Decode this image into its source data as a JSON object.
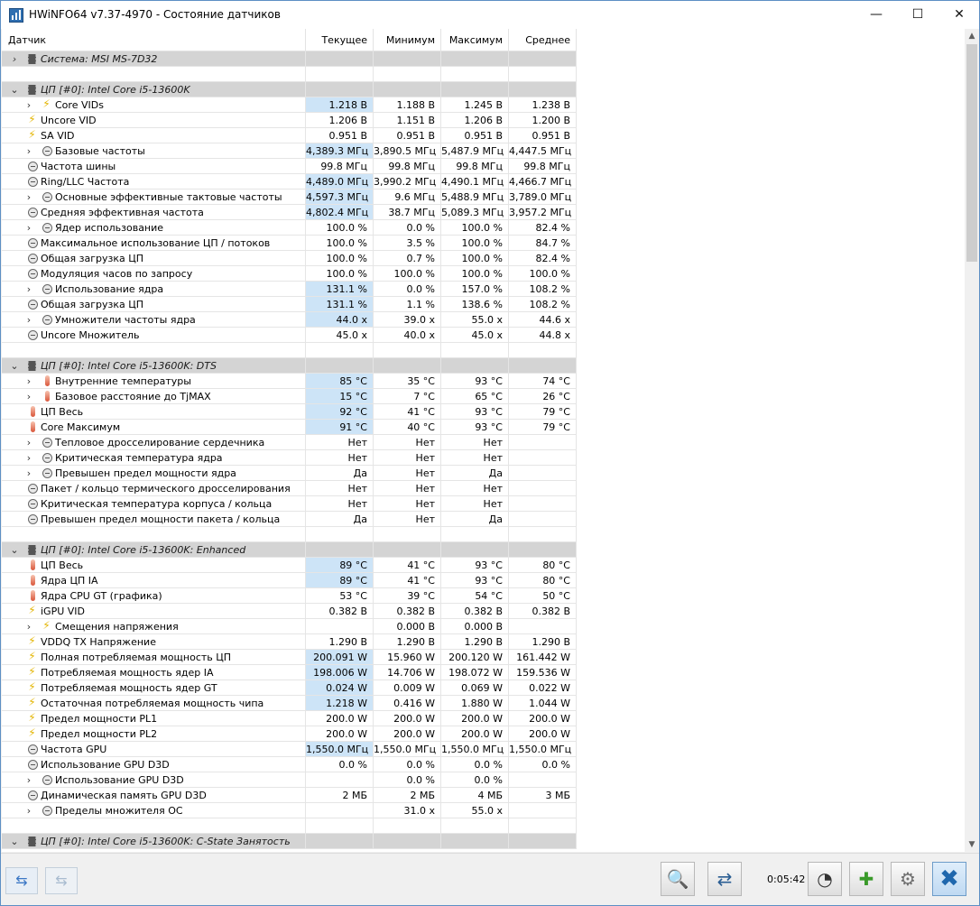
{
  "window": {
    "title": "HWiNFO64 v7.37-4970 - Состояние датчиков",
    "controls": {
      "minimize": "—",
      "maximize": "☐",
      "close": "✕"
    }
  },
  "columns": [
    "Датчик",
    "Текущее",
    "Минимум",
    "Максимум",
    "Среднее"
  ],
  "rows": [
    {
      "t": "section",
      "chev": "right",
      "label": "Система: MSI MS-7D32",
      "vals": [
        "",
        "",
        "",
        ""
      ]
    },
    {
      "t": "spacer"
    },
    {
      "t": "section",
      "chev": "down",
      "label": "ЦП [#0]: Intel Core i5-13600K",
      "vals": [
        "",
        "",
        "",
        ""
      ]
    },
    {
      "t": "item",
      "chev": true,
      "icon": "bolt",
      "label": "Core VIDs",
      "vals": [
        "1.218 В",
        "1.188 В",
        "1.245 В",
        "1.238 В"
      ],
      "hl": true
    },
    {
      "t": "item",
      "icon": "bolt",
      "label": "Uncore VID",
      "vals": [
        "1.206 В",
        "1.151 В",
        "1.206 В",
        "1.200 В"
      ]
    },
    {
      "t": "item",
      "icon": "bolt",
      "label": "SA VID",
      "vals": [
        "0.951 В",
        "0.951 В",
        "0.951 В",
        "0.951 В"
      ]
    },
    {
      "t": "item",
      "chev": true,
      "icon": "clock",
      "label": "Базовые частоты",
      "vals": [
        "4,389.3 МГц",
        "3,890.5 МГц",
        "5,487.9 МГц",
        "4,447.5 МГц"
      ],
      "hl": true
    },
    {
      "t": "item",
      "icon": "clock",
      "label": "Частота шины",
      "vals": [
        "99.8 МГц",
        "99.8 МГц",
        "99.8 МГц",
        "99.8 МГц"
      ]
    },
    {
      "t": "item",
      "icon": "clock",
      "label": "Ring/LLC Частота",
      "vals": [
        "4,489.0 МГц",
        "3,990.2 МГц",
        "4,490.1 МГц",
        "4,466.7 МГц"
      ],
      "hl": true
    },
    {
      "t": "item",
      "chev": true,
      "icon": "clock",
      "label": "Основные эффективные тактовые частоты",
      "vals": [
        "4,597.3 МГц",
        "9.6 МГц",
        "5,488.9 МГц",
        "3,789.0 МГц"
      ],
      "hl": true
    },
    {
      "t": "item",
      "icon": "clock",
      "label": "Средняя эффективная частота",
      "vals": [
        "4,802.4 МГц",
        "38.7 МГц",
        "5,089.3 МГц",
        "3,957.2 МГц"
      ],
      "hl": true
    },
    {
      "t": "item",
      "chev": true,
      "icon": "clock",
      "label": "Ядер использование",
      "vals": [
        "100.0 %",
        "0.0 %",
        "100.0 %",
        "82.4 %"
      ]
    },
    {
      "t": "item",
      "icon": "clock",
      "label": "Максимальное использование ЦП / потоков",
      "vals": [
        "100.0 %",
        "3.5 %",
        "100.0 %",
        "84.7 %"
      ]
    },
    {
      "t": "item",
      "icon": "clock",
      "label": "Общая загрузка ЦП",
      "vals": [
        "100.0 %",
        "0.7 %",
        "100.0 %",
        "82.4 %"
      ]
    },
    {
      "t": "item",
      "icon": "clock",
      "label": "Модуляция часов по запросу",
      "vals": [
        "100.0 %",
        "100.0 %",
        "100.0 %",
        "100.0 %"
      ]
    },
    {
      "t": "item",
      "chev": true,
      "icon": "clock",
      "label": "Использование ядра",
      "vals": [
        "131.1 %",
        "0.0 %",
        "157.0 %",
        "108.2 %"
      ],
      "hl": true
    },
    {
      "t": "item",
      "icon": "clock",
      "label": "Общая загрузка ЦП",
      "vals": [
        "131.1 %",
        "1.1 %",
        "138.6 %",
        "108.2 %"
      ],
      "hl": true
    },
    {
      "t": "item",
      "chev": true,
      "icon": "clock",
      "label": "Умножители частоты ядра",
      "vals": [
        "44.0 x",
        "39.0 x",
        "55.0 x",
        "44.6 x"
      ],
      "hl": true
    },
    {
      "t": "item",
      "icon": "clock",
      "label": "Uncore Множитель",
      "vals": [
        "45.0 x",
        "40.0 x",
        "45.0 x",
        "44.8 x"
      ]
    },
    {
      "t": "spacer"
    },
    {
      "t": "section",
      "chev": "down",
      "label": "ЦП [#0]: Intel Core i5-13600K: DTS",
      "vals": [
        "",
        "",
        "",
        ""
      ]
    },
    {
      "t": "item",
      "chev": true,
      "icon": "therm",
      "label": "Внутренние температуры",
      "vals": [
        "85 °C",
        "35 °C",
        "93 °C",
        "74 °C"
      ],
      "hl": true
    },
    {
      "t": "item",
      "chev": true,
      "icon": "therm",
      "label": "Базовое расстояние до TjMAX",
      "vals": [
        "15 °C",
        "7 °C",
        "65 °C",
        "26 °C"
      ],
      "hl": true
    },
    {
      "t": "item",
      "icon": "therm",
      "label": "ЦП Весь",
      "vals": [
        "92 °C",
        "41 °C",
        "93 °C",
        "79 °C"
      ],
      "hl": true
    },
    {
      "t": "item",
      "icon": "therm",
      "label": "Core Максимум",
      "vals": [
        "91 °C",
        "40 °C",
        "93 °C",
        "79 °C"
      ],
      "hl": true
    },
    {
      "t": "item",
      "chev": true,
      "icon": "clock",
      "label": "Тепловое дросселирование сердечника",
      "vals": [
        "Нет",
        "Нет",
        "Нет",
        ""
      ]
    },
    {
      "t": "item",
      "chev": true,
      "icon": "clock",
      "label": "Критическая температура ядра",
      "vals": [
        "Нет",
        "Нет",
        "Нет",
        ""
      ]
    },
    {
      "t": "item",
      "chev": true,
      "icon": "clock",
      "label": "Превышен предел мощности ядра",
      "vals": [
        "Да",
        "Нет",
        "Да",
        ""
      ]
    },
    {
      "t": "item",
      "icon": "clock",
      "label": "Пакет / кольцо термического дросселирования",
      "vals": [
        "Нет",
        "Нет",
        "Нет",
        ""
      ]
    },
    {
      "t": "item",
      "icon": "clock",
      "label": "Критическая температура корпуса / кольца",
      "vals": [
        "Нет",
        "Нет",
        "Нет",
        ""
      ]
    },
    {
      "t": "item",
      "icon": "clock",
      "label": "Превышен предел мощности пакета / кольца",
      "vals": [
        "Да",
        "Нет",
        "Да",
        ""
      ]
    },
    {
      "t": "spacer"
    },
    {
      "t": "section",
      "chev": "down",
      "label": "ЦП [#0]: Intel Core i5-13600K: Enhanced",
      "vals": [
        "",
        "",
        "",
        ""
      ]
    },
    {
      "t": "item",
      "icon": "therm",
      "label": "ЦП Весь",
      "vals": [
        "89 °C",
        "41 °C",
        "93 °C",
        "80 °C"
      ],
      "hl": true
    },
    {
      "t": "item",
      "icon": "therm",
      "label": "Ядра ЦП IA",
      "vals": [
        "89 °C",
        "41 °C",
        "93 °C",
        "80 °C"
      ],
      "hl": true
    },
    {
      "t": "item",
      "icon": "therm",
      "label": "Ядра CPU GT (графика)",
      "vals": [
        "53 °C",
        "39 °C",
        "54 °C",
        "50 °C"
      ]
    },
    {
      "t": "item",
      "icon": "bolt",
      "label": "iGPU VID",
      "vals": [
        "0.382 В",
        "0.382 В",
        "0.382 В",
        "0.382 В"
      ]
    },
    {
      "t": "item",
      "chev": true,
      "icon": "bolt",
      "label": "Смещения напряжения",
      "vals": [
        "",
        "0.000 В",
        "0.000 В",
        ""
      ]
    },
    {
      "t": "item",
      "icon": "bolt",
      "label": "VDDQ TX Напряжение",
      "vals": [
        "1.290 В",
        "1.290 В",
        "1.290 В",
        "1.290 В"
      ]
    },
    {
      "t": "item",
      "icon": "bolt",
      "label": "Полная потребляемая мощность ЦП",
      "vals": [
        "200.091 W",
        "15.960 W",
        "200.120 W",
        "161.442 W"
      ],
      "hl": true
    },
    {
      "t": "item",
      "icon": "bolt",
      "label": "Потребляемая мощность ядер IA",
      "vals": [
        "198.006 W",
        "14.706 W",
        "198.072 W",
        "159.536 W"
      ],
      "hl": true
    },
    {
      "t": "item",
      "icon": "bolt",
      "label": "Потребляемая мощность ядер GT",
      "vals": [
        "0.024 W",
        "0.009 W",
        "0.069 W",
        "0.022 W"
      ],
      "hl": true
    },
    {
      "t": "item",
      "icon": "bolt",
      "label": "Остаточная потребляемая мощность чипа",
      "vals": [
        "1.218 W",
        "0.416 W",
        "1.880 W",
        "1.044 W"
      ],
      "hl": true
    },
    {
      "t": "item",
      "icon": "bolt",
      "label": "Предел мощности PL1",
      "vals": [
        "200.0 W",
        "200.0 W",
        "200.0 W",
        "200.0 W"
      ]
    },
    {
      "t": "item",
      "icon": "bolt",
      "label": "Предел мощности PL2",
      "vals": [
        "200.0 W",
        "200.0 W",
        "200.0 W",
        "200.0 W"
      ]
    },
    {
      "t": "item",
      "icon": "clock",
      "label": "Частота GPU",
      "vals": [
        "1,550.0 МГц",
        "1,550.0 МГц",
        "1,550.0 МГц",
        "1,550.0 МГц"
      ],
      "hl": true
    },
    {
      "t": "item",
      "icon": "clock",
      "label": "Использование GPU D3D",
      "vals": [
        "0.0 %",
        "0.0 %",
        "0.0 %",
        "0.0 %"
      ]
    },
    {
      "t": "item",
      "chev": true,
      "icon": "clock",
      "label": "Использование GPU D3D",
      "vals": [
        "",
        "0.0 %",
        "0.0 %",
        ""
      ]
    },
    {
      "t": "item",
      "icon": "clock",
      "label": "Динамическая память GPU D3D",
      "vals": [
        "2 МБ",
        "2 МБ",
        "4 МБ",
        "3 МБ"
      ]
    },
    {
      "t": "item",
      "chev": true,
      "icon": "clock",
      "label": "Пределы множителя OC",
      "vals": [
        "",
        "31.0 x",
        "55.0 x",
        ""
      ]
    },
    {
      "t": "spacer"
    },
    {
      "t": "section",
      "chev": "down",
      "label": "ЦП [#0]: Intel Core i5-13600K: C-State Занятость",
      "vals": [
        "",
        "",
        "",
        ""
      ]
    }
  ],
  "bottombar": {
    "timer": "0:05:42",
    "nav_prev_icon": "arrow-left-right-icon",
    "nav_next_icon": "arrow-left-right-disabled-icon",
    "tools": [
      "report-icon",
      "network-icon",
      "clock-icon",
      "add-log-icon",
      "settings-icon",
      "close-icon"
    ]
  }
}
